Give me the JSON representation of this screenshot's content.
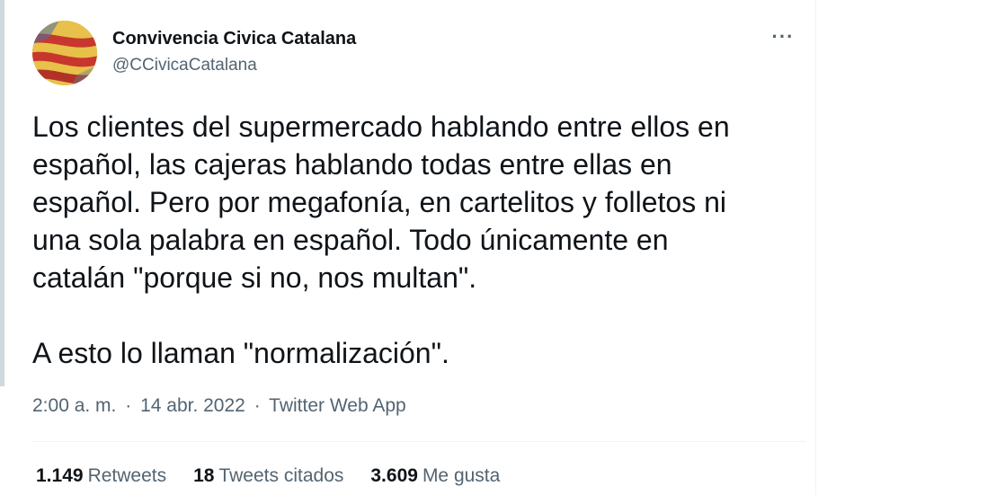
{
  "tweet": {
    "author": {
      "display_name": "Convivencia Civica Catalana",
      "handle": "@CCivicaCatalana",
      "avatar_icon": "flag-avatar-icon"
    },
    "more_icon": "more-options-icon",
    "more_glyph": "···",
    "text": "Los clientes del supermercado hablando entre ellos en\nespañol, las cajeras hablando todas entre ellas en\nespañol. Pero por megafonía, en cartelitos y folletos ni\nuna sola palabra en español. Todo únicamente en\ncatalán \"porque si no, nos multan\".\n\nA esto lo llaman \"normalización\".",
    "time": "2:00 a. m.",
    "date": "14 abr. 2022",
    "source": "Twitter Web App",
    "separator": "·",
    "stats": {
      "retweets": {
        "count": "1.149",
        "label": "Retweets"
      },
      "quotes": {
        "count": "18",
        "label": "Tweets citados"
      },
      "likes": {
        "count": "3.609",
        "label": "Me gusta"
      }
    }
  },
  "colors": {
    "text_primary": "#0f1419",
    "text_secondary": "#536471",
    "divider": "#eff3f4"
  }
}
